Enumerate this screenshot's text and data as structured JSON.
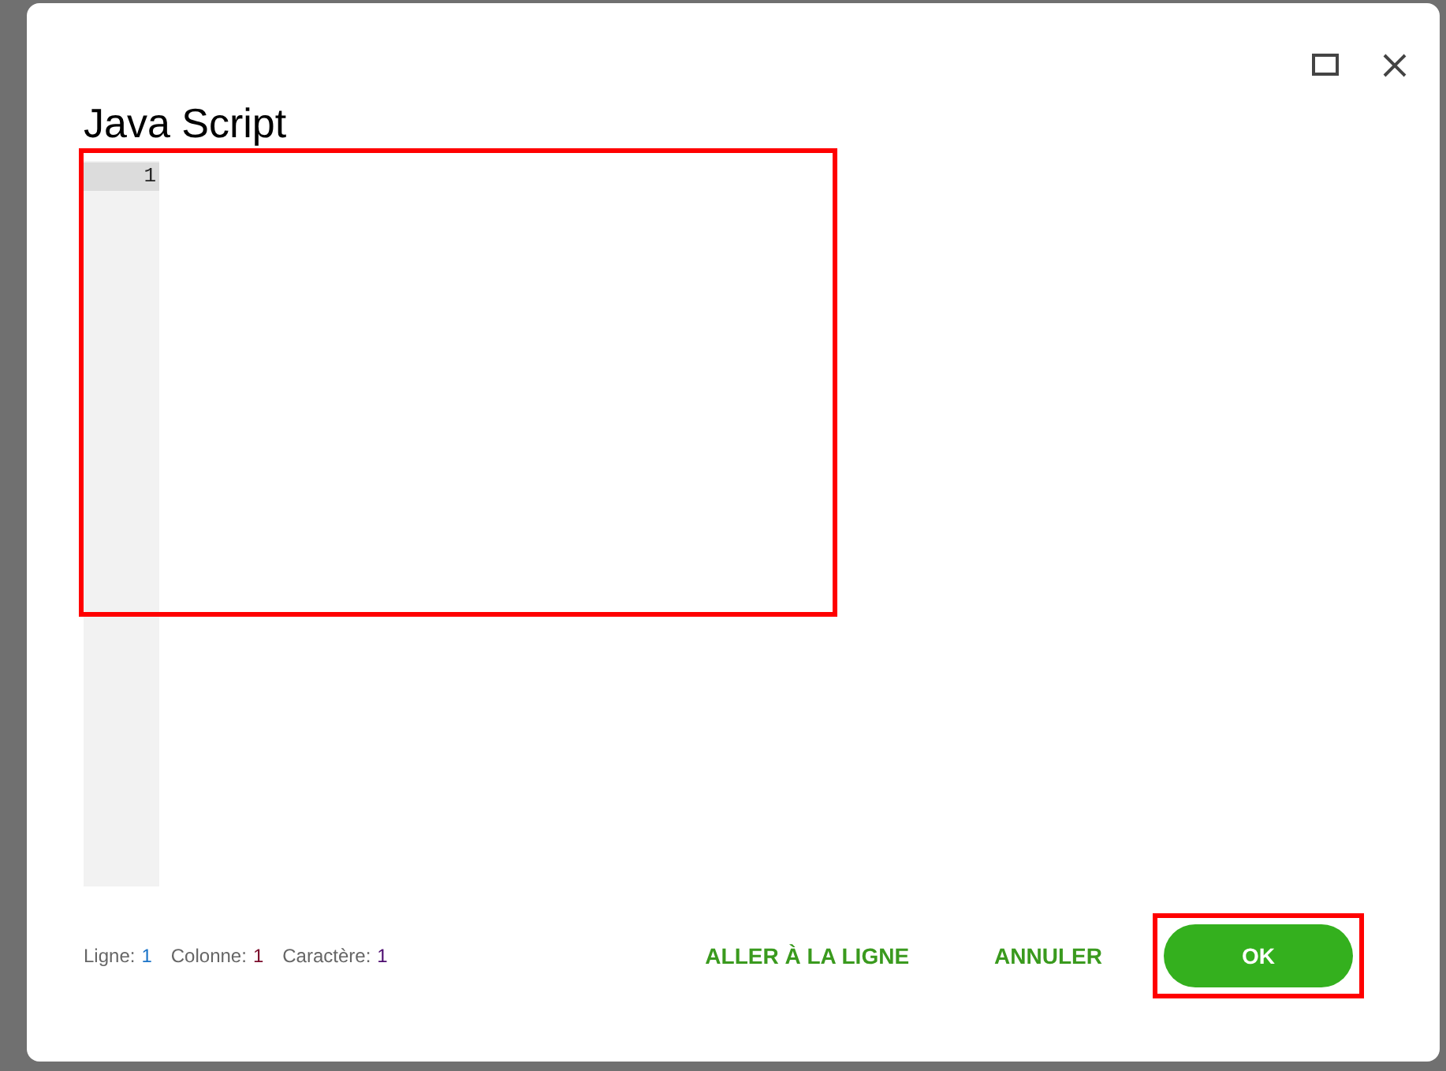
{
  "dialog": {
    "title": "Java Script"
  },
  "editor": {
    "highlighted": true,
    "line_numbers": [
      {
        "number": "1",
        "selected": true
      }
    ]
  },
  "status": [
    {
      "label": "Ligne:",
      "value": "1",
      "color": "#1a73c8"
    },
    {
      "label": "Colonne:",
      "value": "1",
      "color": "#7a0a2a"
    },
    {
      "label": "Caractère:",
      "value": "1",
      "color": "#4b0a6e"
    }
  ],
  "buttons": [
    {
      "label": "ALLER À LA LIGNE",
      "kind": "text"
    },
    {
      "label": "ANNULER",
      "kind": "text"
    },
    {
      "label": "OK",
      "kind": "primary",
      "highlighted": true
    }
  ]
}
